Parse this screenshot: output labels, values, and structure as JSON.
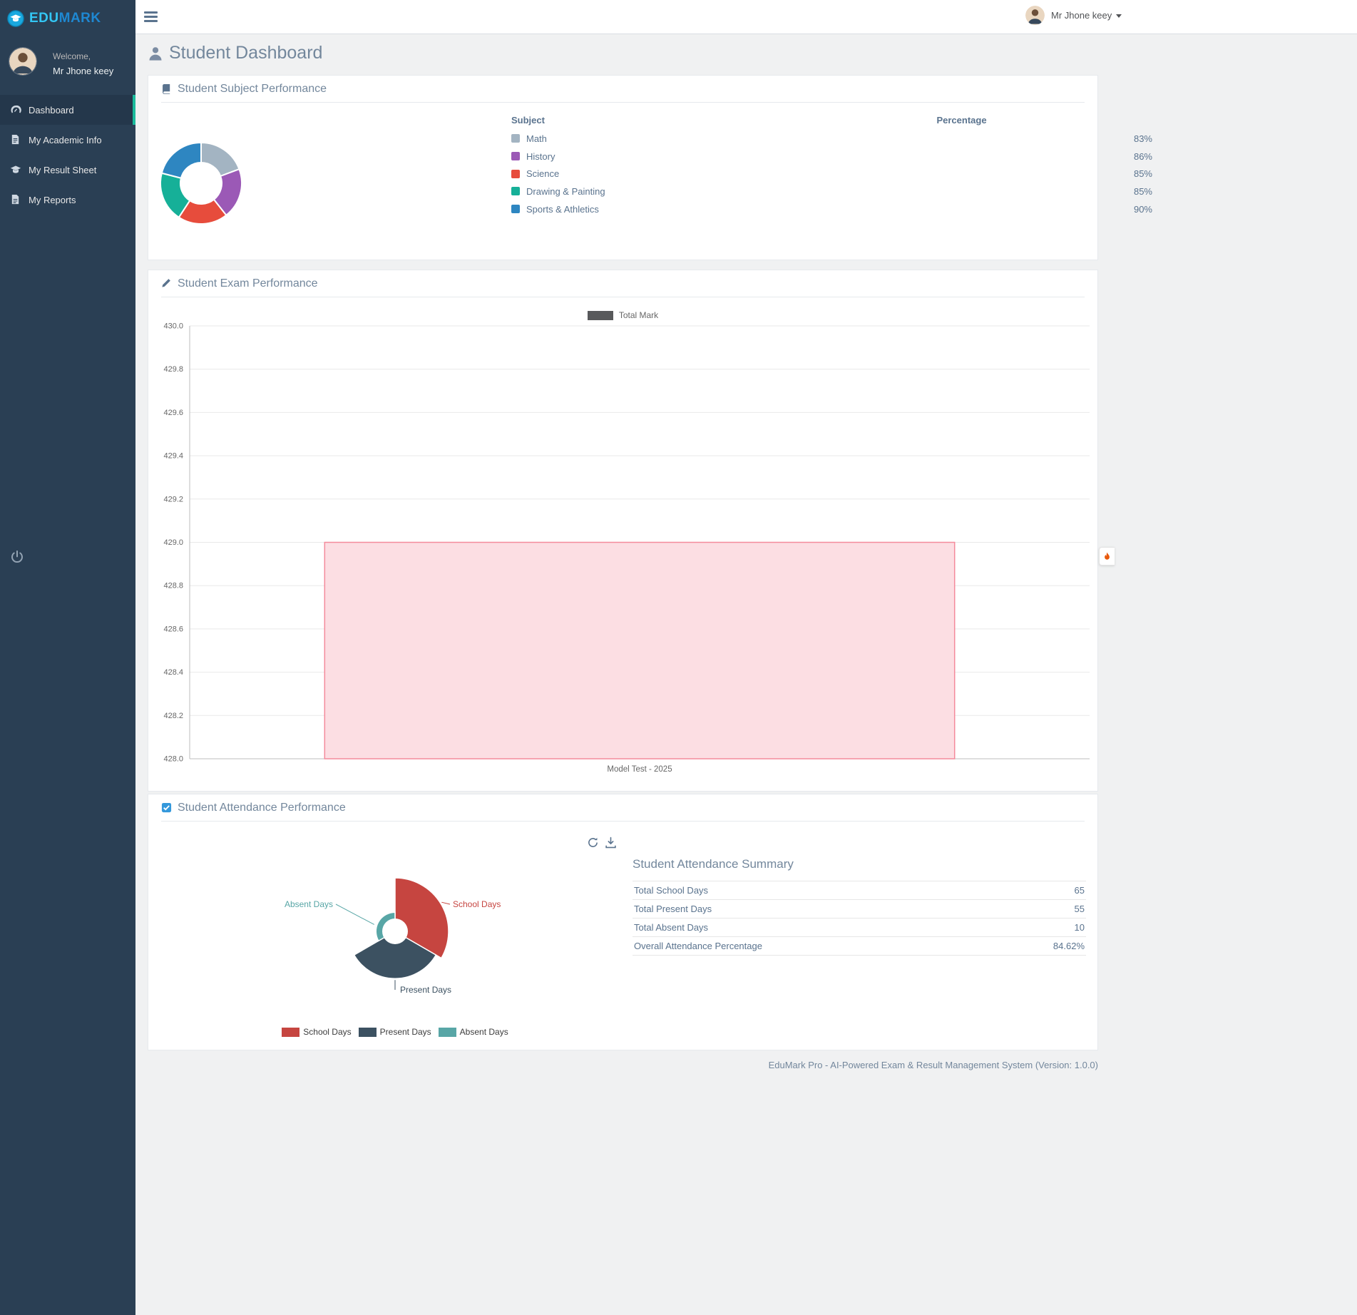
{
  "brand": {
    "logo_part1": "EDU",
    "logo_part2": "MARK",
    "logo_color1": "#33c6f4",
    "logo_color2": "#1e88d2"
  },
  "topbar": {
    "user_name": "Mr Jhone keey"
  },
  "sidebar": {
    "welcome_label": "Welcome,",
    "user_name": "Mr Jhone keey",
    "items": [
      {
        "label": "Dashboard",
        "active": true
      },
      {
        "label": "My Academic Info",
        "active": false
      },
      {
        "label": "My Result Sheet",
        "active": false
      },
      {
        "label": "My Reports",
        "active": false
      }
    ]
  },
  "page": {
    "title": "Student Dashboard"
  },
  "cards": {
    "subject": {
      "title": "Student Subject Performance",
      "col_subject": "Subject",
      "col_percentage": "Percentage"
    },
    "exam": {
      "title": "Student Exam Performance"
    },
    "attendance": {
      "title": "Student Attendance Performance",
      "summary_title": "Student Attendance Summary",
      "summary_rows": [
        {
          "label": "Total School Days",
          "value": "65"
        },
        {
          "label": "Total Present Days",
          "value": "55"
        },
        {
          "label": "Total Absent Days",
          "value": "10"
        },
        {
          "label": "Overall Attendance Percentage",
          "value": "84.62%"
        }
      ]
    }
  },
  "footer": {
    "text": "EduMark Pro - AI-Powered Exam & Result Management System (Version: 1.0.0)"
  },
  "chart_data": [
    {
      "type": "pie",
      "variant": "doughnut",
      "title": "Student Subject Performance",
      "labels": [
        "Math",
        "History",
        "Science",
        "Drawing & Painting",
        "Sports & Athletics"
      ],
      "values": [
        83,
        86,
        85,
        85,
        90
      ],
      "percent_labels": [
        "83%",
        "86%",
        "85%",
        "85%",
        "90%"
      ],
      "colors": [
        "#a3b4c2",
        "#9b59b6",
        "#e74c3c",
        "#16b098",
        "#2e86c1"
      ],
      "legend_position": "right-table"
    },
    {
      "type": "bar",
      "title": "Student Exam Performance",
      "categories": [
        "Model Test - 2025"
      ],
      "series": [
        {
          "name": "Total Mark",
          "values": [
            429.0
          ]
        }
      ],
      "ylim": [
        428.0,
        430.0
      ],
      "ytick_step": 0.2,
      "bar_fill": "#fcdee3",
      "bar_border": "#f48a9b",
      "legend_swatch_color": "#58595b",
      "grid": true,
      "legend_position": "top"
    },
    {
      "type": "polarArea",
      "title": "Student Attendance Performance",
      "labels": [
        "School Days",
        "Present Days",
        "Absent Days"
      ],
      "values": [
        65,
        55,
        10
      ],
      "colors": [
        "#c64540",
        "#3c5161",
        "#58a6a6"
      ]
    }
  ]
}
